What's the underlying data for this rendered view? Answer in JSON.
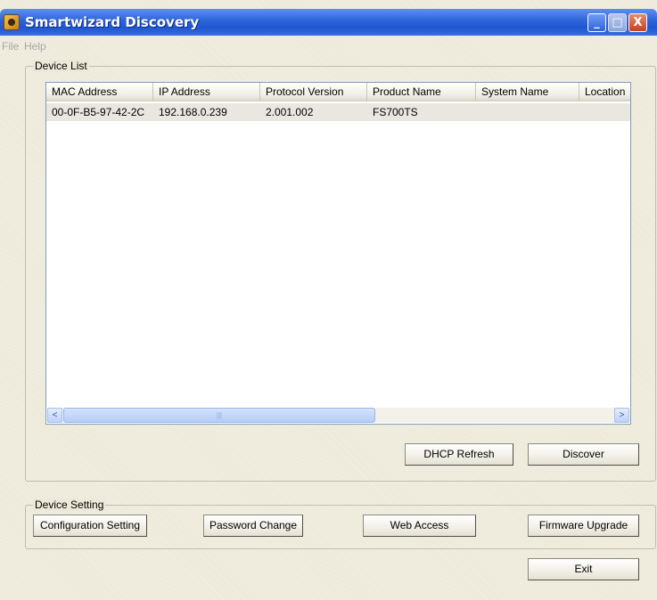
{
  "window": {
    "title": "Smartwizard Discovery",
    "buttons": {
      "minimize": "_",
      "maximize": "□",
      "close": "X"
    }
  },
  "menu": {
    "file": "File",
    "help": "Help"
  },
  "device_list": {
    "legend": "Device List",
    "columns": [
      "MAC Address",
      "IP Address",
      "Protocol Version",
      "Product Name",
      "System Name",
      "Location"
    ],
    "rows": [
      {
        "mac": "00-0F-B5-97-42-2C",
        "ip": "192.168.0.239",
        "protocol": "2.001.002",
        "product": "FS700TS",
        "system": "",
        "location": ""
      }
    ],
    "scrollbar": {
      "left_arrow": "<",
      "right_arrow": ">",
      "thumb_grip": "|||"
    },
    "buttons": {
      "dhcp_refresh": "DHCP Refresh",
      "discover": "Discover"
    }
  },
  "device_setting": {
    "legend": "Device Setting",
    "buttons": {
      "configuration": "Configuration Setting",
      "password": "Password Change",
      "web_access": "Web Access",
      "firmware": "Firmware Upgrade"
    }
  },
  "footer": {
    "exit": "Exit"
  },
  "colors": {
    "titlebar": "#2d63da",
    "dialog_bg": "#ece9d8",
    "selected_row": "#e9e7e0"
  }
}
